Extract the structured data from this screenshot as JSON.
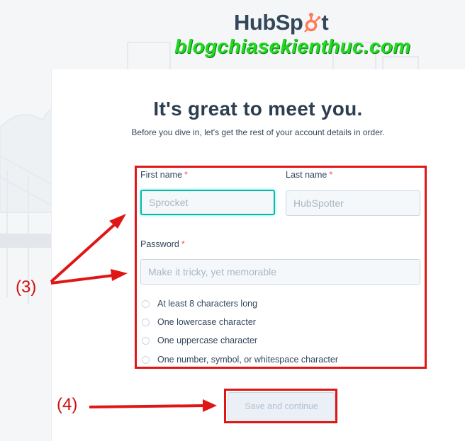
{
  "logo": {
    "text_left": "HubSp",
    "text_right": "t"
  },
  "watermark": "blogchiasekienthuc.com",
  "title": "It's great to meet you.",
  "subtitle": "Before you dive in, let's get the rest of your account details in order.",
  "form": {
    "first_name": {
      "label": "First name",
      "required": "*",
      "placeholder": "Sprocket"
    },
    "last_name": {
      "label": "Last name",
      "required": "*",
      "placeholder": "HubSpotter"
    },
    "password": {
      "label": "Password",
      "required": "*",
      "placeholder": "Make it tricky, yet memorable"
    },
    "requirements": [
      "At least 8 characters long",
      "One lowercase character",
      "One uppercase character",
      "One number, symbol, or whitespace character"
    ],
    "submit_label": "Save and continue"
  },
  "annotations": {
    "step3": "(3)",
    "step4": "(4)"
  },
  "colors": {
    "brand_orange": "#ff7a59",
    "text_dark": "#2d3e50",
    "focus_teal": "#00bda5",
    "annotation_red": "#e01616",
    "watermark_green": "#22d822"
  }
}
